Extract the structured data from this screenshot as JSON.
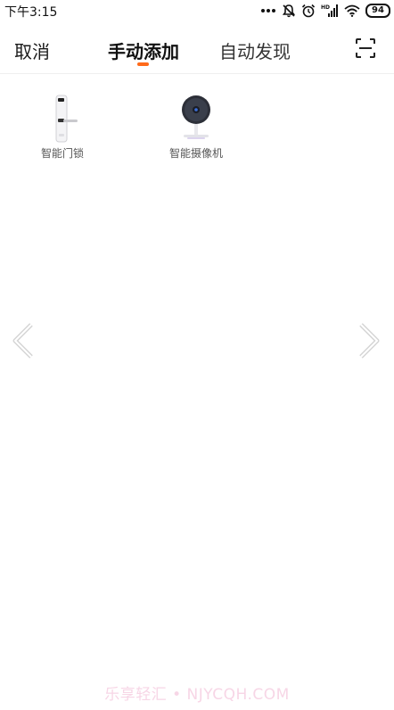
{
  "status_bar": {
    "time": "下午3:15",
    "battery": "94",
    "icons": [
      "dots-icon",
      "mute-bell-icon",
      "alarm-icon",
      "hd-signal-icon",
      "wifi-icon",
      "battery-icon"
    ]
  },
  "header": {
    "cancel_label": "取消",
    "tabs": [
      {
        "label": "手动添加",
        "active": true
      },
      {
        "label": "自动发现",
        "active": false
      }
    ],
    "scan_icon": "scan-icon",
    "accent_color": "#ff6a1a"
  },
  "devices": [
    {
      "label": "智能门锁",
      "icon": "smart-lock-icon"
    },
    {
      "label": "智能摄像机",
      "icon": "camera-icon"
    }
  ],
  "pager": {
    "prev_icon": "chevron-left-icon",
    "next_icon": "chevron-right-icon"
  },
  "watermark": "乐享轻汇 • NJYCQH.COM"
}
